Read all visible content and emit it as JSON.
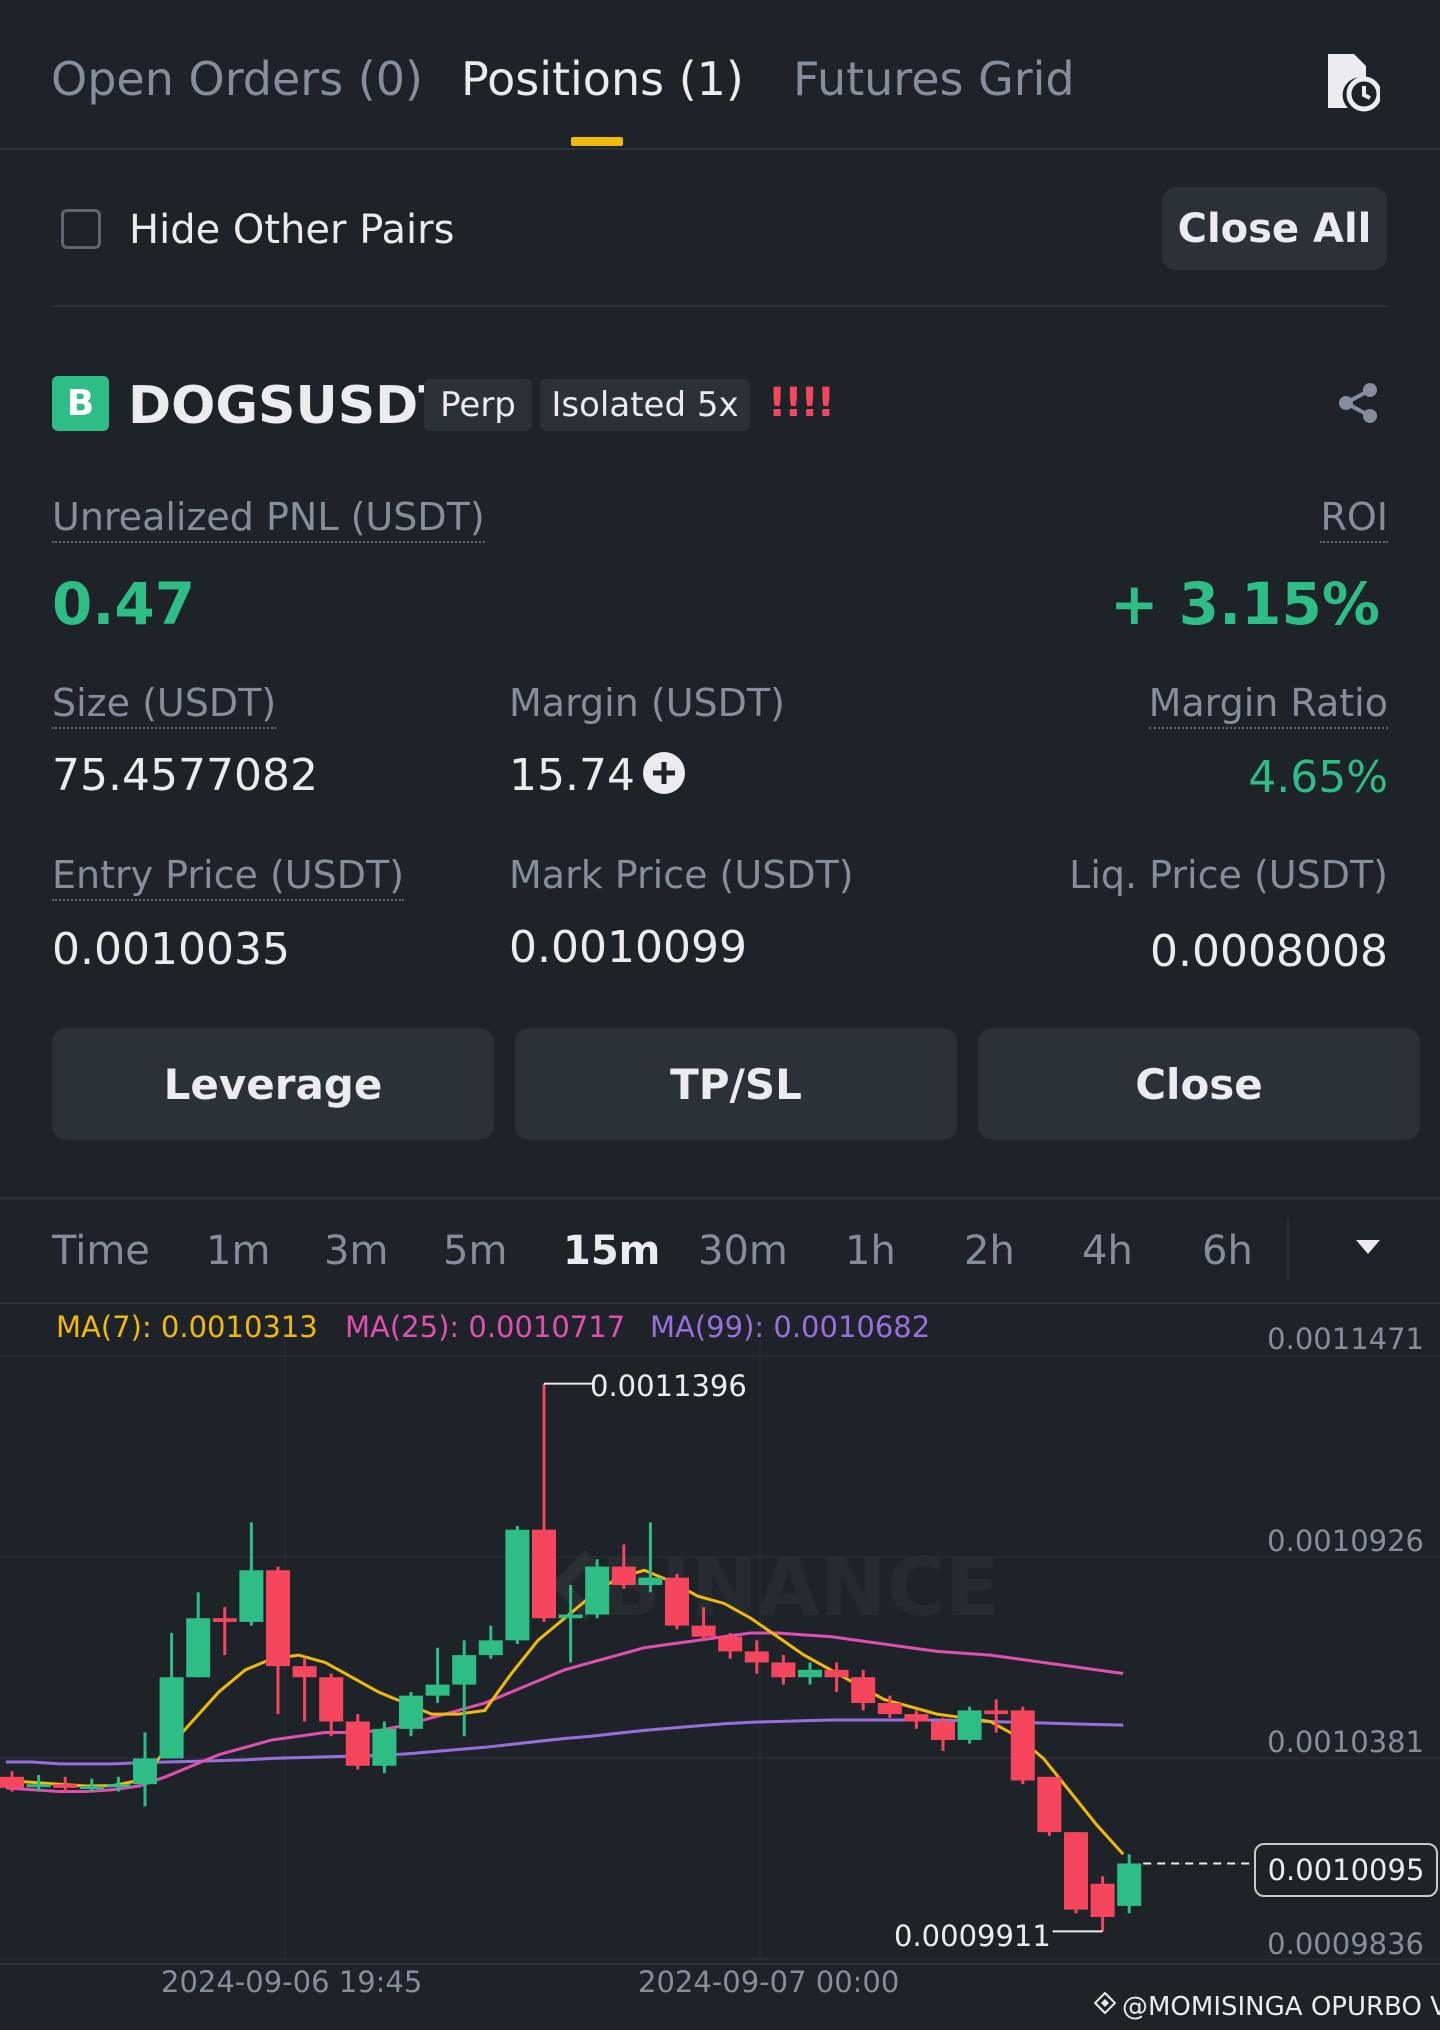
{
  "tabs": [
    {
      "label": "Open Orders (0)"
    },
    {
      "label": "Positions (1)"
    },
    {
      "label": "Futures Grid"
    }
  ],
  "filter": {
    "hide_other_pairs": "Hide Other Pairs",
    "close_all": "Close All"
  },
  "position": {
    "coin_letter": "B",
    "symbol": "DOGSUSDT",
    "tag_perp": "Perp",
    "tag_margin": "Isolated 5x",
    "risk_marker": "!!!!",
    "unrealized_pnl_label": "Unrealized PNL (USDT)",
    "unrealized_pnl_value": "0.47",
    "roi_label": "ROI",
    "roi_value": "+ 3.15%",
    "size_label": "Size (USDT)",
    "size_value": "75.4577082",
    "margin_label": "Margin (USDT)",
    "margin_value": "15.74",
    "margin_ratio_label": "Margin Ratio",
    "margin_ratio_value": "4.65%",
    "entry_label": "Entry Price (USDT)",
    "entry_value": "0.0010035",
    "mark_label": "Mark Price (USDT)",
    "mark_value": "0.0010099",
    "liq_label": "Liq. Price (USDT)",
    "liq_value": "0.0008008"
  },
  "actions": {
    "leverage": "Leverage",
    "tpsl": "TP/SL",
    "close": "Close"
  },
  "intervals": [
    "Time",
    "1m",
    "3m",
    "5m",
    "15m",
    "30m",
    "1h",
    "2h",
    "4h",
    "6h"
  ],
  "selected_interval": "15m",
  "ma": {
    "ma7": "MA(7): 0.0010313",
    "ma25": "MA(25): 0.0010717",
    "ma99": "MA(99): 0.0010682"
  },
  "colors": {
    "up": "#2ebd85",
    "down": "#f6465d",
    "ma7": "#f0b90b",
    "ma25": "#e04fb2",
    "ma99": "#9b6ede",
    "accent": "#f0b90b"
  },
  "chart_data": {
    "type": "candlestick",
    "y_ticks": [
      "0.0011471",
      "0.0010926",
      "0.0010381",
      "0.0009836"
    ],
    "x_ticks": [
      "2024-09-06 19:45",
      "2024-09-07 00:00"
    ],
    "high_label": "0.0011396",
    "low_label": "0.0009911",
    "last_price": "0.0010095",
    "ylim": [
      0.00098,
      0.00115
    ],
    "candles": [
      {
        "o": 0.001033,
        "c": 0.00103,
        "h": 0.0010345,
        "l": 0.001029
      },
      {
        "o": 0.0010305,
        "c": 0.001031,
        "h": 0.0010335,
        "l": 0.001029
      },
      {
        "o": 0.001031,
        "c": 0.00103,
        "h": 0.001033,
        "l": 0.001029
      },
      {
        "o": 0.0010305,
        "c": 0.0010305,
        "h": 0.0010325,
        "l": 0.001029
      },
      {
        "o": 0.0010305,
        "c": 0.001031,
        "h": 0.001033,
        "l": 0.001029
      },
      {
        "o": 0.001031,
        "c": 0.001038,
        "h": 0.001045,
        "l": 0.001025
      },
      {
        "o": 0.001038,
        "c": 0.00106,
        "h": 0.001072,
        "l": 0.001038
      },
      {
        "o": 0.00106,
        "c": 0.001076,
        "h": 0.001083,
        "l": 0.00106
      },
      {
        "o": 0.001076,
        "c": 0.001075,
        "h": 0.001079,
        "l": 0.001066
      },
      {
        "o": 0.001075,
        "c": 0.001089,
        "h": 0.001102,
        "l": 0.001074
      },
      {
        "o": 0.001089,
        "c": 0.001063,
        "h": 0.00109,
        "l": 0.00105
      },
      {
        "o": 0.001063,
        "c": 0.00106,
        "h": 0.001065,
        "l": 0.001048
      },
      {
        "o": 0.00106,
        "c": 0.001048,
        "h": 0.001061,
        "l": 0.001044
      },
      {
        "o": 0.001048,
        "c": 0.001036,
        "h": 0.00105,
        "l": 0.001035
      },
      {
        "o": 0.001036,
        "c": 0.001046,
        "h": 0.001048,
        "l": 0.001034
      },
      {
        "o": 0.001046,
        "c": 0.001055,
        "h": 0.001056,
        "l": 0.001044
      },
      {
        "o": 0.001055,
        "c": 0.001058,
        "h": 0.001068,
        "l": 0.001053
      },
      {
        "o": 0.001058,
        "c": 0.001066,
        "h": 0.00107,
        "l": 0.001044
      },
      {
        "o": 0.001066,
        "c": 0.00107,
        "h": 0.001074,
        "l": 0.001065
      },
      {
        "o": 0.00107,
        "c": 0.0011,
        "h": 0.001101,
        "l": 0.001069
      },
      {
        "o": 0.0011,
        "c": 0.001076,
        "h": 0.0011396,
        "l": 0.001075
      },
      {
        "o": 0.001076,
        "c": 0.001077,
        "h": 0.001085,
        "l": 0.001064
      },
      {
        "o": 0.001077,
        "c": 0.00109,
        "h": 0.001092,
        "l": 0.001076
      },
      {
        "o": 0.00109,
        "c": 0.001085,
        "h": 0.001096,
        "l": 0.001084
      },
      {
        "o": 0.001085,
        "c": 0.001087,
        "h": 0.001102,
        "l": 0.001083
      },
      {
        "o": 0.001087,
        "c": 0.001074,
        "h": 0.001088,
        "l": 0.001073
      },
      {
        "o": 0.001074,
        "c": 0.001071,
        "h": 0.001079,
        "l": 0.00107
      },
      {
        "o": 0.001071,
        "c": 0.001067,
        "h": 0.001072,
        "l": 0.001065
      },
      {
        "o": 0.001067,
        "c": 0.001064,
        "h": 0.00107,
        "l": 0.001061
      },
      {
        "o": 0.001064,
        "c": 0.00106,
        "h": 0.001066,
        "l": 0.001058
      },
      {
        "o": 0.00106,
        "c": 0.001062,
        "h": 0.001064,
        "l": 0.001058
      },
      {
        "o": 0.001062,
        "c": 0.00106,
        "h": 0.001064,
        "l": 0.001056
      },
      {
        "o": 0.00106,
        "c": 0.001053,
        "h": 0.001062,
        "l": 0.001051
      },
      {
        "o": 0.001053,
        "c": 0.00105,
        "h": 0.001055,
        "l": 0.001049
      },
      {
        "o": 0.00105,
        "c": 0.001048,
        "h": 0.001051,
        "l": 0.001046
      },
      {
        "o": 0.001048,
        "c": 0.001043,
        "h": 0.001049,
        "l": 0.00104
      },
      {
        "o": 0.001043,
        "c": 0.001051,
        "h": 0.001052,
        "l": 0.001042
      },
      {
        "o": 0.001051,
        "c": 0.00105,
        "h": 0.001054,
        "l": 0.001045
      },
      {
        "o": 0.001051,
        "c": 0.001032,
        "h": 0.001052,
        "l": 0.001031
      },
      {
        "o": 0.001033,
        "c": 0.001018,
        "h": 0.001033,
        "l": 0.001017
      },
      {
        "o": 0.001018,
        "c": 0.000997,
        "h": 0.001018,
        "l": 0.000996
      },
      {
        "o": 0.001004,
        "c": 0.000995,
        "h": 0.001006,
        "l": 0.0009911
      },
      {
        "o": 0.000998,
        "c": 0.0010095,
        "h": 0.001012,
        "l": 0.000996
      }
    ],
    "ma7_line": [
      0.001032,
      0.0010315,
      0.001031,
      0.0010305,
      0.0010306,
      0.001032,
      0.00104,
      0.001048,
      0.001056,
      0.001062,
      0.001065,
      0.001066,
      0.001064,
      0.00106,
      0.001056,
      0.001053,
      0.00105,
      0.00105,
      0.001051,
      0.001061,
      0.00107,
      0.001076,
      0.001082,
      0.001087,
      0.001089,
      0.001086,
      0.001082,
      0.00108,
      0.001076,
      0.001071,
      0.001066,
      0.001062,
      0.001058,
      0.001054,
      0.001052,
      0.00105,
      0.001049,
      0.001048,
      0.001044,
      0.001038,
      0.001029,
      0.00102,
      0.001012
    ],
    "ma25_line": [
      0.00103,
      0.0010295,
      0.001029,
      0.001029,
      0.0010295,
      0.0010305,
      0.001033,
      0.001036,
      0.001039,
      0.001041,
      0.001043,
      0.001044,
      0.001045,
      0.001045,
      0.0010455,
      0.001047,
      0.001049,
      0.001051,
      0.001053,
      0.001056,
      0.001059,
      0.001062,
      0.001064,
      0.001066,
      0.001068,
      0.001069,
      0.00107,
      0.001071,
      0.001072,
      0.001072,
      0.0010715,
      0.001071,
      0.00107,
      0.001069,
      0.001068,
      0.001067,
      0.0010665,
      0.001066,
      0.001065,
      0.001064,
      0.001063,
      0.001062,
      0.001061
    ],
    "ma99_line": [
      0.001037,
      0.001037,
      0.0010365,
      0.0010365,
      0.0010365,
      0.0010368,
      0.001037,
      0.0010372,
      0.0010374,
      0.0010376,
      0.001038,
      0.0010382,
      0.0010384,
      0.0010386,
      0.0010388,
      0.0010392,
      0.0010398,
      0.0010404,
      0.001041,
      0.0010418,
      0.0010426,
      0.0010434,
      0.001044,
      0.0010448,
      0.0010456,
      0.0010462,
      0.0010468,
      0.0010474,
      0.0010478,
      0.001048,
      0.0010482,
      0.0010484,
      0.0010484,
      0.0010484,
      0.0010484,
      0.0010484,
      0.0010482,
      0.001048,
      0.0010478,
      0.0010476,
      0.0010474,
      0.0010472,
      0.001047
    ]
  },
  "credit": "@MOMISINGA OPURBO VAI"
}
